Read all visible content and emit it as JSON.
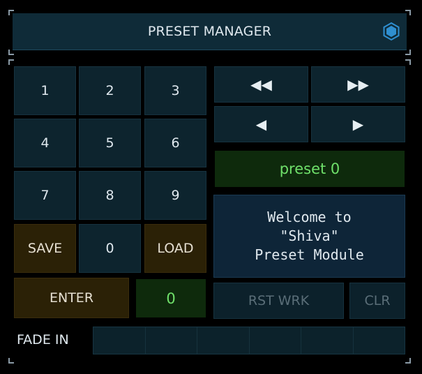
{
  "header": {
    "title": "PRESET MANAGER",
    "icon": "hexagon-icon",
    "icon_color": "#2f8fd0"
  },
  "keypad": {
    "keys": [
      "1",
      "2",
      "3",
      "4",
      "5",
      "6",
      "7",
      "8",
      "9"
    ],
    "save": "SAVE",
    "zero": "0",
    "load": "LOAD",
    "enter": "ENTER",
    "entry_value": "0"
  },
  "transport": {
    "rewind": "◀◀",
    "fast_forward": "▶▶",
    "prev": "◀",
    "next": "▶"
  },
  "preset_display": "preset 0",
  "message": {
    "line1": "Welcome to",
    "line2": "\"Shiva\"",
    "line3": "Preset Module"
  },
  "actions": {
    "reset_work": "RST WRK",
    "clear": "CLR"
  },
  "fade": {
    "label": "FADE IN",
    "level": 0
  },
  "colors": {
    "accent_green": "#6fe06a",
    "brown_button": "#2b2106",
    "panel": "#0d242e"
  }
}
